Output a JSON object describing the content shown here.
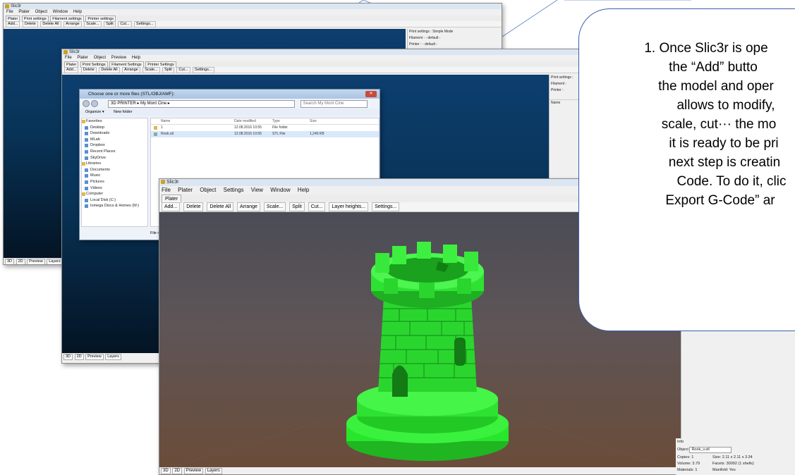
{
  "back_window": {
    "title": "Slic3r",
    "menu": [
      "File",
      "Plater",
      "Object",
      "Window",
      "Help"
    ],
    "tabs": [
      "Plater",
      "Print settings",
      "Filament settings",
      "Printer settings"
    ],
    "toolbar": [
      "Add...",
      "Delete",
      "Delete All",
      "Arrange",
      "Scale...",
      "Split",
      "Cut...",
      "Settings..."
    ],
    "side": [
      {
        "label": "Print settings :",
        "value": "Simple Mode"
      },
      {
        "label": "Filament :",
        "value": "- default -"
      },
      {
        "label": "Printer :",
        "value": "- default -"
      }
    ],
    "status_tabs": [
      "3D",
      "2D",
      "Preview",
      "Layers"
    ]
  },
  "middle_window": {
    "title": "Slic3r",
    "menu": [
      "File",
      "Plater",
      "Object",
      "Preview",
      "Help"
    ],
    "tabs": [
      "Plater",
      "Print Settings",
      "Filament Settings",
      "Printer Settings"
    ],
    "toolbar": [
      "Add...",
      "Delete",
      "Delete All",
      "Arrange",
      "Scale...",
      "Split",
      "Cut...",
      "Settings..."
    ],
    "side": [
      {
        "label": "Print settings :",
        "value": ""
      },
      {
        "label": "Filament :",
        "value": ""
      },
      {
        "label": "Printer :",
        "value": ""
      }
    ],
    "list_header": "Name",
    "status_tabs": [
      "3D",
      "2D",
      "Preview",
      "Layers"
    ]
  },
  "file_dialog": {
    "title": "Choose one or more files (STL/OBJ/AMF):",
    "path": "3D PRINTER  ▸  My Mont Cine  ▸",
    "search_placeholder": "Search My Mont Cine",
    "organize": "Organize ▾",
    "new_folder": "New folder",
    "nav": [
      {
        "label": "Favorites",
        "group": true
      },
      {
        "label": "Desktop",
        "group": false
      },
      {
        "label": "Downloads",
        "group": false
      },
      {
        "label": "MLab",
        "group": false
      },
      {
        "label": "Dropbox",
        "group": false
      },
      {
        "label": "Recent Places",
        "group": false
      },
      {
        "label": "SkyDrive",
        "group": false
      },
      {
        "label": "",
        "group": false
      },
      {
        "label": "Libraries",
        "group": true
      },
      {
        "label": "Documents",
        "group": false
      },
      {
        "label": "Music",
        "group": false
      },
      {
        "label": "Pictures",
        "group": false
      },
      {
        "label": "Videos",
        "group": false
      },
      {
        "label": "",
        "group": false
      },
      {
        "label": "Computer",
        "group": true
      },
      {
        "label": "Local Disk (C:)",
        "group": false
      },
      {
        "label": "Iomega Disco & Homes (M:)",
        "group": false
      }
    ],
    "columns": [
      "Name",
      "Date modified",
      "Type",
      "Size"
    ],
    "rows": [
      {
        "name": "1",
        "date": "12.08.2016 10:55",
        "type": "File folder",
        "size": ""
      },
      {
        "name": "Rook.stl",
        "date": "12.08.2016 10:55",
        "type": "STL File",
        "size": "1,240 KB"
      }
    ],
    "filename_label": "File name:",
    "filename_value": "MEMMU..."
  },
  "main_window": {
    "title": "Slic3r",
    "menu": [
      "File",
      "Plater",
      "Object",
      "Settings",
      "View",
      "Window",
      "Help"
    ],
    "tabs": [
      "Plater"
    ],
    "toolbar": [
      "Add...",
      "Delete",
      "Delete All",
      "Arrange",
      "Scale...",
      "Split",
      "Cut...",
      "Layer heights...",
      "Settings..."
    ],
    "status_tabs": [
      "3D",
      "2D",
      "Preview",
      "Layers"
    ]
  },
  "info_panel": {
    "heading": "Info",
    "object_label": "Object",
    "object_value": "Rook_v.stl",
    "copies_label": "Copies:",
    "copies_value": "1",
    "size_label": "Size:",
    "size_value": "2.11 x 2.11 x 3.34",
    "volume_label": "Volume:",
    "volume_value": "3.79",
    "facets_label": "Facets:",
    "facets_value": "30092 (1 shells)",
    "materials_label": "Materials:",
    "materials_value": "1",
    "manifold_label": "Manifold:",
    "manifold_value": "Yes"
  },
  "callout": {
    "lines": [
      "1. Once Slic3r is ope",
      "the  “Add”  butto",
      "the model and oper",
      "allows to modify,",
      "scale, cut··· the mo",
      "it is ready to be pri",
      "next step is creatin",
      "Code. To do it, clic",
      "Export G-Code”  ar"
    ]
  },
  "colors": {
    "model": "#27e62b",
    "callout_border": "#3d5fae",
    "viewport_blue": "#0b3a66"
  }
}
